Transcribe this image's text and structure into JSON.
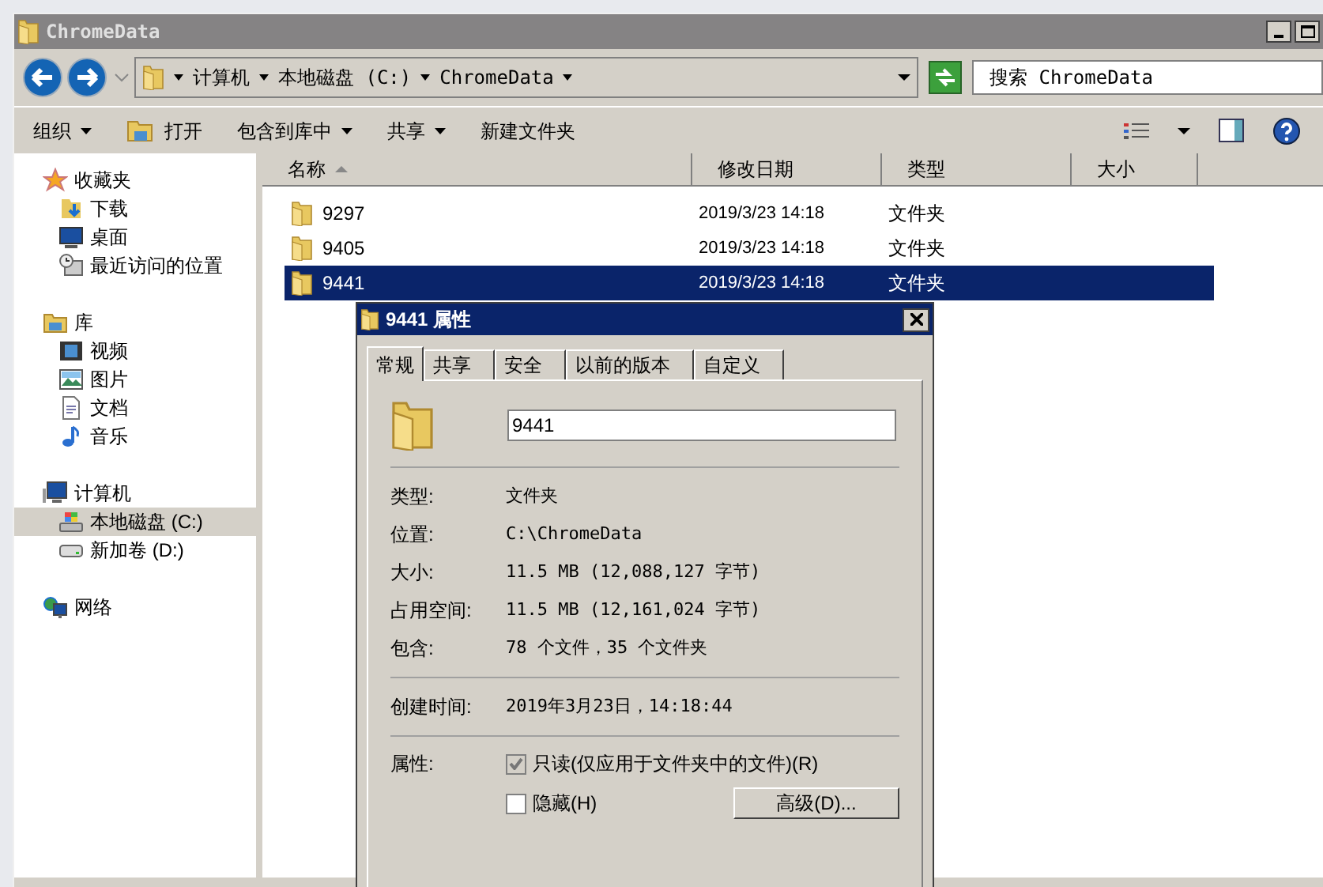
{
  "window": {
    "title": "ChromeData"
  },
  "address": {
    "breadcrumb": [
      "计算机",
      "本地磁盘 (C:)",
      "ChromeData"
    ]
  },
  "search": {
    "placeholder": "搜索 ChromeData"
  },
  "toolbar": [
    {
      "label": "组织",
      "kind": "menu"
    },
    {
      "label": "打开",
      "kind": "icon"
    },
    {
      "label": "包含到库中",
      "kind": "menu"
    },
    {
      "label": "共享",
      "kind": "menu"
    },
    {
      "label": "新建文件夹",
      "kind": "button"
    }
  ],
  "sidebar": [
    {
      "label": "收藏夹",
      "kind": "star",
      "children": [
        {
          "label": "下载",
          "kind": "download",
          "selected": false
        },
        {
          "label": "桌面",
          "kind": "desktop",
          "selected": false
        },
        {
          "label": "最近访问的位置",
          "kind": "recent",
          "selected": false
        }
      ]
    },
    {
      "label": "库",
      "kind": "library",
      "children": [
        {
          "label": "视频",
          "kind": "video",
          "selected": false
        },
        {
          "label": "图片",
          "kind": "picture",
          "selected": false
        },
        {
          "label": "文档",
          "kind": "document",
          "selected": false
        },
        {
          "label": "音乐",
          "kind": "music",
          "selected": false
        }
      ]
    },
    {
      "label": "计算机",
      "kind": "computer",
      "children": [
        {
          "label": "本地磁盘 (C:)",
          "kind": "systemdrive",
          "selected": true
        },
        {
          "label": "新加卷 (D:)",
          "kind": "drive",
          "selected": false
        }
      ]
    },
    {
      "label": "网络",
      "kind": "network"
    }
  ],
  "table": {
    "columns": [
      {
        "label": "名称",
        "sorted": true
      },
      {
        "label": "修改日期",
        "sorted": false
      },
      {
        "label": "类型",
        "sorted": false
      },
      {
        "label": "大小",
        "sorted": false
      }
    ],
    "rows": [
      {
        "name": "9297",
        "modified": "2019/3/23 14:18",
        "type": "文件夹",
        "selected": false
      },
      {
        "name": "9405",
        "modified": "2019/3/23 14:18",
        "type": "文件夹",
        "selected": false
      },
      {
        "name": "9441",
        "modified": "2019/3/23 14:18",
        "type": "文件夹",
        "selected": true
      }
    ]
  },
  "dialog": {
    "title": "9441 属性",
    "tabs": [
      {
        "label": "常规",
        "selected": true
      },
      {
        "label": "共享",
        "selected": false
      },
      {
        "label": "安全",
        "selected": false
      },
      {
        "label": "以前的版本",
        "selected": false
      },
      {
        "label": "自定义",
        "selected": false
      }
    ],
    "name_value": "9441",
    "sections": [
      [
        {
          "label": "类型:",
          "value": "文件夹"
        },
        {
          "label": "位置:",
          "value": "C:\\ChromeData"
        },
        {
          "label": "大小:",
          "value": "11.5 MB (12,088,127 字节)"
        },
        {
          "label": "占用空间:",
          "value": "11.5 MB (12,161,024 字节)"
        },
        {
          "label": "包含:",
          "value": "78 个文件，35 个文件夹"
        }
      ],
      [
        {
          "label": "创建时间:",
          "value": "2019年3月23日，14:18:44"
        }
      ]
    ],
    "attributes_label": "属性:",
    "attributes": [
      {
        "label": "只读(仅应用于文件夹中的文件)(R)",
        "checked": true
      },
      {
        "label": "隐藏(H)",
        "checked": false
      }
    ],
    "advanced_button": "高级(D)..."
  }
}
